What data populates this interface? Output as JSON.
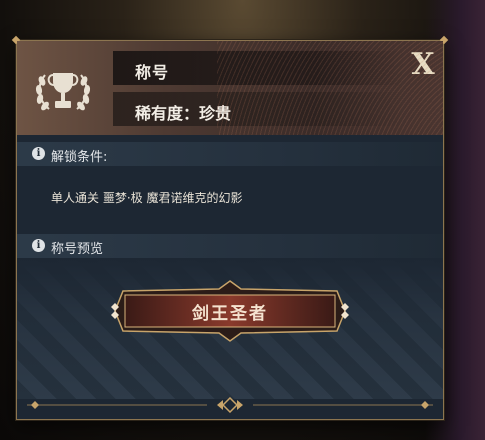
{
  "dialog": {
    "title": "称号",
    "rarity": "稀有度：珍贵",
    "close_glyph": "X"
  },
  "unlock": {
    "header": "解锁条件:",
    "condition": "单人通关 噩梦·极 魔君诺维克的幻影"
  },
  "preview": {
    "header": "称号预览",
    "title_badge": "剑王圣者"
  },
  "icons": [
    "trophy-laurel-icon",
    "info-icon",
    "close-icon"
  ],
  "colors": {
    "gold": "#c8a46a",
    "panel_bg": "#1d2733",
    "header_brown": "#4e3a32",
    "badge_red": "#7a3328"
  }
}
